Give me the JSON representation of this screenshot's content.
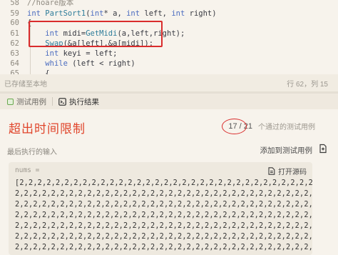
{
  "editor": {
    "lines": [
      {
        "num": "58",
        "text": "//hoare版本"
      },
      {
        "num": "59",
        "text": "int PartSort1(int* a, int left, int right)"
      },
      {
        "num": "60",
        "text": "{"
      },
      {
        "num": "61",
        "text": "    int midi=GetMidi(a,left,right);"
      },
      {
        "num": "62",
        "text": "    Swap(&a[left],&a[midi]);"
      },
      {
        "num": "63",
        "text": "    int keyi = left;"
      },
      {
        "num": "64",
        "text": "    while (left < right)"
      },
      {
        "num": "65",
        "text": "    {"
      }
    ]
  },
  "statusbar": {
    "saved": "已存储至本地",
    "position": "行 62，列 15"
  },
  "tabs": [
    {
      "label": "测试用例",
      "icon": "checkbox-icon",
      "color": "#6aa84f"
    },
    {
      "label": "执行结果",
      "icon": "terminal-icon",
      "color": "#3b3b3b"
    }
  ],
  "result": {
    "title": "超出时间限制",
    "passed": "17 / 21",
    "passed_label": "个通过的测试用例",
    "last_input_label": "最后执行的输入",
    "add_case": "添加到测试用例",
    "input_var": "nums =",
    "open_source": "打开源码",
    "data_lines": [
      "[2,2,2,2,2,2,2,2,2,2,2,2,2,2,2,2,2,2,2,2,2,2,2,2,2,2,2,2,2,2,2,2,2,2,",
      "2,2,2,2,2,2,2,2,2,2,2,2,2,2,2,2,2,2,2,2,2,2,2,2,2,2,2,2,2,2,2,2,2,2,",
      "2,2,2,2,2,2,2,2,2,2,2,2,2,2,2,2,2,2,2,2,2,2,2,2,2,2,2,2,2,2,2,2,2,2,",
      "2,2,2,2,2,2,2,2,2,2,2,2,2,2,2,2,2,2,2,2,2,2,2,2,2,2,2,2,2,2,2,2,2,2,",
      "2,2,2,2,2,2,2,2,2,2,2,2,2,2,2,2,2,2,2,2,2,2,2,2,2,2,2,2,2,2,2,2,2,2,",
      "2,2,2,2,2,2,2,2,2,2,2,2,2,2,2,2,2,2,2,2,2,2,2,2,2,2,2,2,2,2,2,2,2,2,",
      "2,2,2,2,2,2,2,2,2,2,2,2,2,2,2,2,2,2,2,2,2,2,2,2,2,2,2,2,2,2,2,2,2,2,"
    ]
  },
  "colors": {
    "accent_red": "#e0452b",
    "annotation_red": "#d92c2c"
  }
}
